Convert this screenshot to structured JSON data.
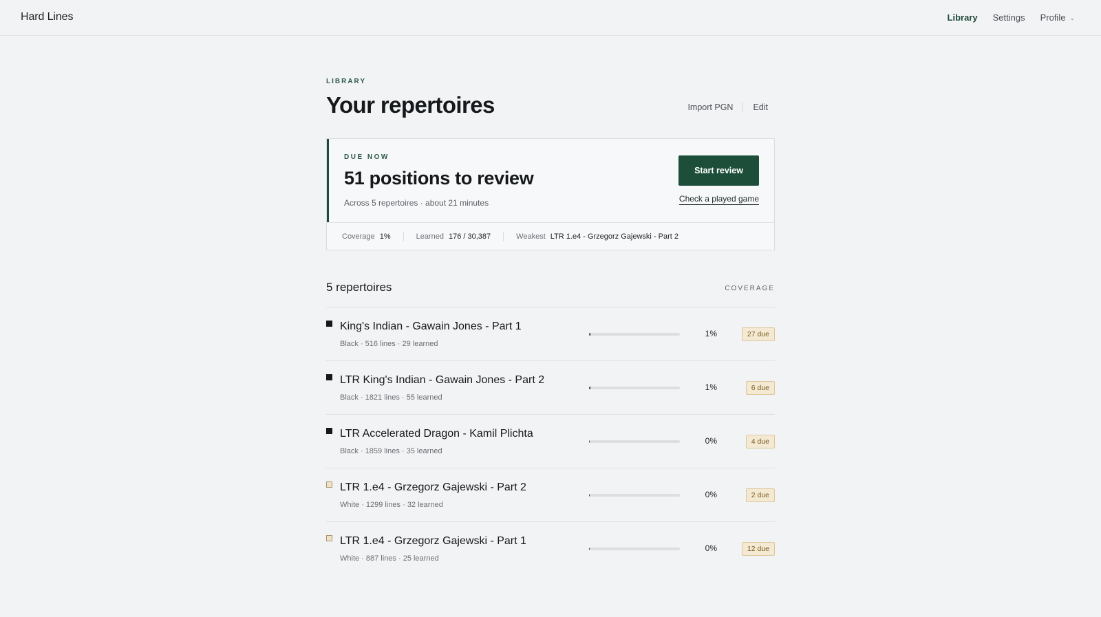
{
  "app": {
    "title": "Hard Lines"
  },
  "nav": {
    "library": "Library",
    "settings": "Settings",
    "profile": "Profile"
  },
  "page": {
    "eyebrow": "LIBRARY",
    "title": "Your repertoires",
    "import_label": "Import PGN",
    "edit_label": "Edit"
  },
  "due": {
    "label": "DUE NOW",
    "count_text": "51 positions to review",
    "subtitle": "Across 5 repertoires · about 21 minutes",
    "start_label": "Start review",
    "check_label": "Check a played game",
    "stats": {
      "coverage_label": "Coverage",
      "coverage_value": "1%",
      "learned_label": "Learned",
      "learned_value": "176 / 30,387",
      "weakest_label": "Weakest",
      "weakest_value": "LTR 1.e4 - Grzegorz Gajewski - Part 2"
    }
  },
  "list": {
    "title": "5 repertoires",
    "coverage_header": "COVERAGE",
    "items": [
      {
        "name": "King's Indian - Gawain Jones - Part 1",
        "meta": "Black · 516 lines · 29 learned",
        "side": "black",
        "coverage": 0.01,
        "coverage_text": "1%",
        "due": "27 due"
      },
      {
        "name": "LTR King's Indian - Gawain Jones - Part 2",
        "meta": "Black · 1821 lines · 55 learned",
        "side": "black",
        "coverage": 0.01,
        "coverage_text": "1%",
        "due": "6 due"
      },
      {
        "name": "LTR Accelerated Dragon - Kamil Plichta",
        "meta": "Black · 1859 lines · 35 learned",
        "side": "black",
        "coverage": 0.0,
        "coverage_text": "0%",
        "due": "4 due"
      },
      {
        "name": "LTR 1.e4 - Grzegorz Gajewski - Part 2",
        "meta": "White · 1299 lines · 32 learned",
        "side": "white",
        "coverage": 0.0,
        "coverage_text": "0%",
        "due": "2 due"
      },
      {
        "name": "LTR 1.e4 - Grzegorz Gajewski - Part 1",
        "meta": "White · 887 lines · 25 learned",
        "side": "white",
        "coverage": 0.0,
        "coverage_text": "0%",
        "due": "12 due"
      }
    ]
  },
  "colors": {
    "accent": "#1d4e3a",
    "badge_bg": "#f4ead3",
    "badge_text": "#7a5a1e"
  }
}
